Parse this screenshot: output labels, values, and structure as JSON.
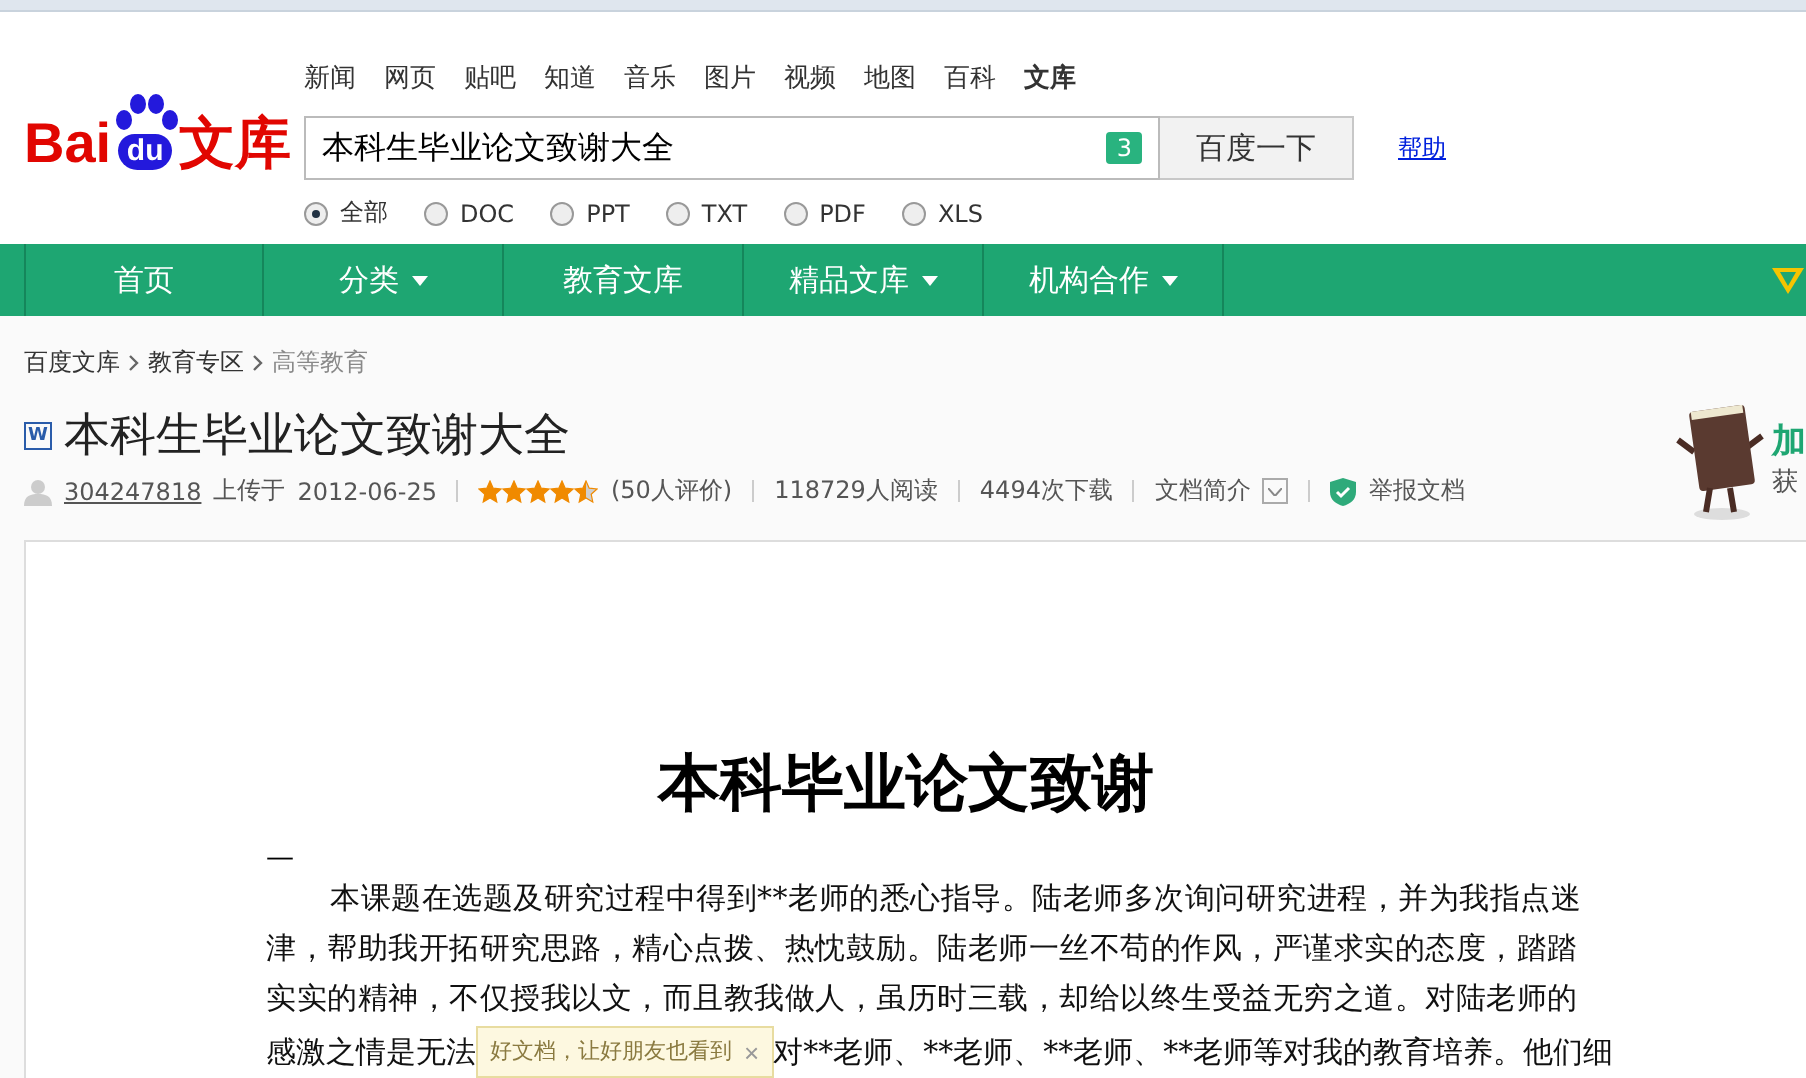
{
  "header": {
    "logo": {
      "latin": "Bai",
      "badge": "du",
      "chinese": "文库"
    },
    "channels": [
      {
        "label": "新闻",
        "selected": false
      },
      {
        "label": "网页",
        "selected": false
      },
      {
        "label": "贴吧",
        "selected": false
      },
      {
        "label": "知道",
        "selected": false
      },
      {
        "label": "音乐",
        "selected": false
      },
      {
        "label": "图片",
        "selected": false
      },
      {
        "label": "视频",
        "selected": false
      },
      {
        "label": "地图",
        "selected": false
      },
      {
        "label": "百科",
        "selected": false
      },
      {
        "label": "文库",
        "selected": true
      }
    ],
    "search": {
      "value": "本科生毕业论文致谢大全",
      "count": "3",
      "button": "百度一下",
      "help": "帮助"
    },
    "filters": [
      {
        "label": "全部",
        "selected": true
      },
      {
        "label": "DOC",
        "selected": false
      },
      {
        "label": "PPT",
        "selected": false
      },
      {
        "label": "TXT",
        "selected": false
      },
      {
        "label": "PDF",
        "selected": false
      },
      {
        "label": "XLS",
        "selected": false
      }
    ]
  },
  "nav": {
    "items": [
      {
        "label": "首页",
        "dropdown": false
      },
      {
        "label": "分类",
        "dropdown": true
      },
      {
        "label": "教育文库",
        "dropdown": false
      },
      {
        "label": "精品文库",
        "dropdown": true
      },
      {
        "label": "机构合作",
        "dropdown": true
      }
    ]
  },
  "breadcrumb": [
    "百度文库",
    "教育专区",
    "高等教育"
  ],
  "document": {
    "file_badge": "W",
    "title": "本科生毕业论文致谢大全",
    "uploader": "304247818",
    "uploaded": "上传于",
    "date": "2012-06-25",
    "stars": 4.5,
    "ratings": "(50人评价)",
    "reads": "118729人阅读",
    "downloads": "4494次下载",
    "summary": "文档简介",
    "report": "举报文档"
  },
  "promo": {
    "title": "加",
    "subtitle": "获"
  },
  "page": {
    "heading": "本科毕业论文致谢",
    "dash": "—",
    "lines": [
      "本课题在选题及研究过程中得到**老师的悉心指导。陆老师多次询问研究进程，并为我指点迷",
      "津，帮助我开拓研究思路，精心点拨、热忱鼓励。陆老师一丝不苟的作风，严谨求实的态度，踏踏",
      "实实的精神，不仅授我以文，而且教我做人，虽历时三载，却给以终生受益无穷之道。对陆老师的"
    ],
    "last_line_start": "感激之情是无法",
    "last_line_end": "对**老师、**老师、**老师、**老师等对我的教育培养。他们细"
  },
  "share_tip": {
    "text": "好文档，让好朋友也看到",
    "close": "×"
  }
}
